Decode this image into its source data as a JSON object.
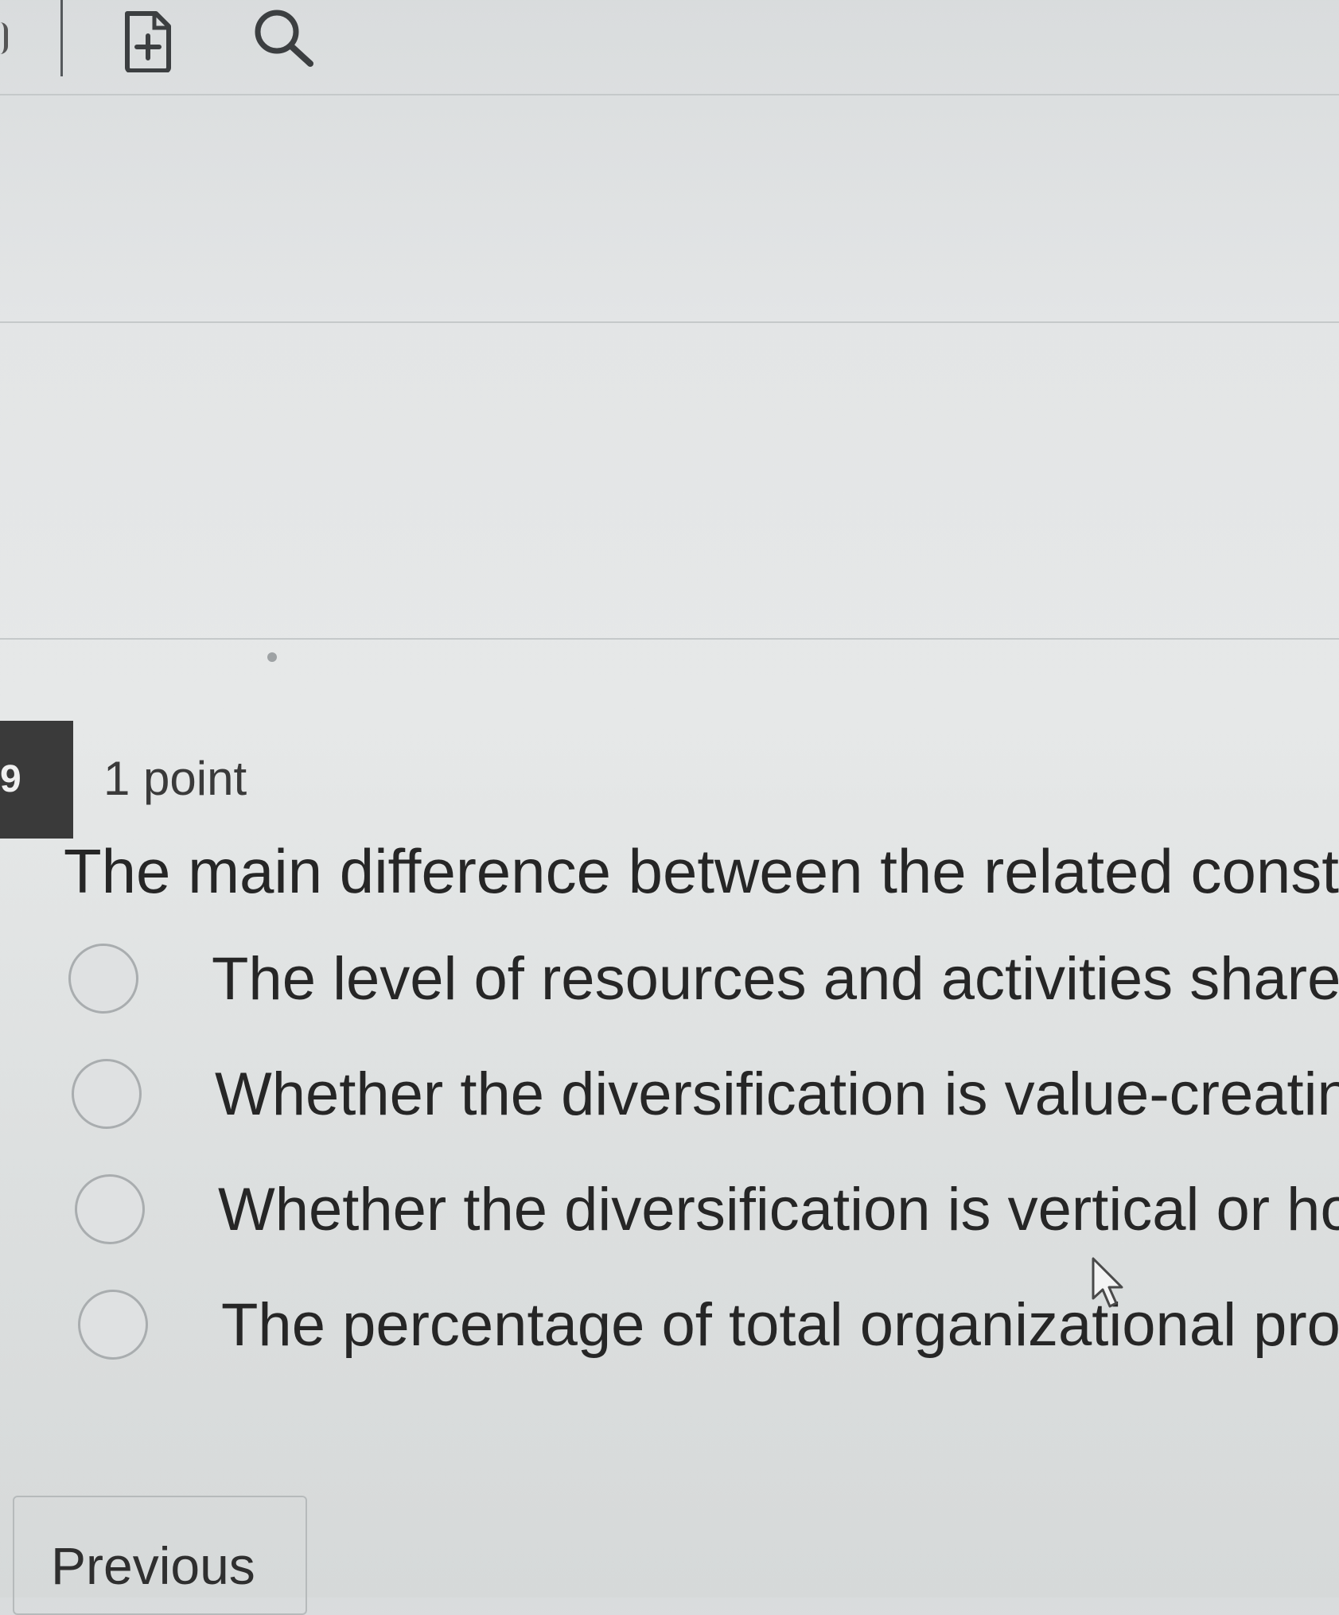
{
  "toolbar": {
    "add_page_icon": "file-plus-icon",
    "search_icon": "search-icon"
  },
  "question": {
    "number": "9",
    "points": "1 point",
    "text": "The main difference between the related constrain",
    "options": [
      {
        "label": "The level of resources and activities shared a",
        "selected": false
      },
      {
        "label": "Whether the diversification is value-creating",
        "selected": false
      },
      {
        "label": "Whether the diversification is vertical or hor",
        "selected": false
      },
      {
        "label": "The percentage of total organizational profit",
        "selected": false
      }
    ]
  },
  "navigation": {
    "previous_label": "Previous"
  },
  "colors": {
    "background": "#e3e5e6",
    "question_badge": "#3a3a3a",
    "text": "#262626"
  }
}
